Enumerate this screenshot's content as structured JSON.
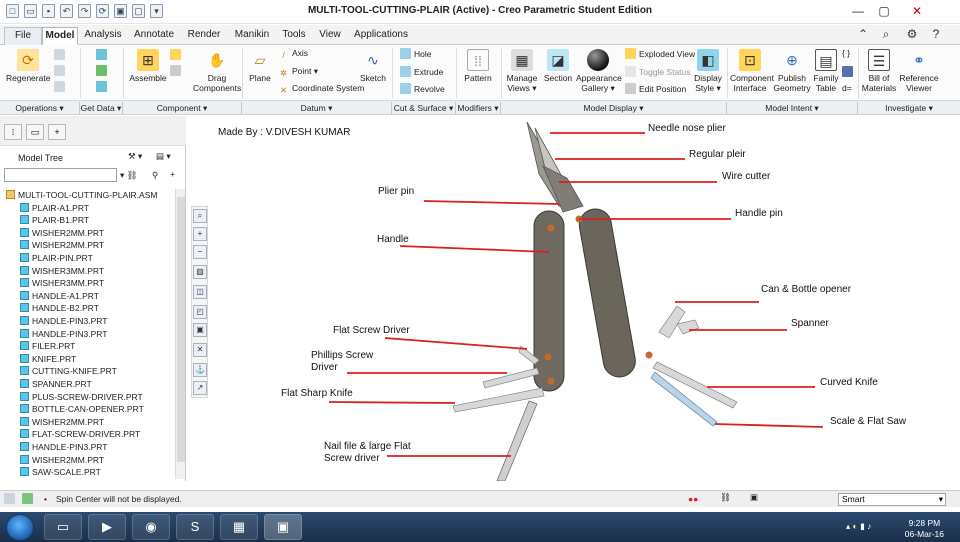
{
  "app": {
    "title": "MULTI-TOOL-CUTTING-PLAIR (Active) - Creo Parametric Student Edition"
  },
  "tabs": [
    "File",
    "Model",
    "Analysis",
    "Annotate",
    "Render",
    "Manikin",
    "Tools",
    "View",
    "Applications"
  ],
  "ribbon": {
    "regenerate": "Regenerate",
    "assemble": "Assemble",
    "drag_components_1": "Drag",
    "drag_components_2": "Components",
    "plane": "Plane",
    "axis": "Axis",
    "point": "Point",
    "coord_system": "Coordinate System",
    "sketch": "Sketch",
    "hole": "Hole",
    "extrude": "Extrude",
    "revolve": "Revolve",
    "pattern": "Pattern",
    "manage_views_1": "Manage",
    "manage_views_2": "Views",
    "section": "Section",
    "appearance_1": "Appearance",
    "appearance_2": "Gallery",
    "exploded_view": "Exploded View",
    "toggle_status": "Toggle Status",
    "edit_position": "Edit Position",
    "display_style_1": "Display",
    "display_style_2": "Style",
    "component_interface_1": "Component",
    "component_interface_2": "Interface",
    "publish_geometry_1": "Publish",
    "publish_geometry_2": "Geometry",
    "family_table_1": "Family",
    "family_table_2": "Table",
    "bill_of_materials_1": "Bill of",
    "bill_of_materials_2": "Materials",
    "reference_viewer_1": "Reference",
    "reference_viewer_2": "Viewer"
  },
  "groups": [
    "Operations",
    "Get Data",
    "Component",
    "Datum",
    "Cut & Surface",
    "Modifiers",
    "Model Display",
    "Model Intent",
    "Investigate"
  ],
  "model_tree": {
    "title": "Model Tree",
    "items": [
      "MULTI-TOOL-CUTTING-PLAIR.ASM",
      "PLAIR-A1.PRT",
      "PLAIR-B1.PRT",
      "WISHER2MM.PRT",
      "WISHER2MM.PRT",
      "PLAIR-PIN.PRT",
      "WISHER3MM.PRT",
      "WISHER3MM.PRT",
      "HANDLE-A1.PRT",
      "HANDLE-B2.PRT",
      "HANDLE-PIN3.PRT",
      "HANDLE-PIN3.PRT",
      "FILER.PRT",
      "KNIFE.PRT",
      "CUTTING-KNIFE.PRT",
      "SPANNER.PRT",
      "PLUS-SCREW-DRIVER.PRT",
      "BOTTLE-CAN-OPENER.PRT",
      "WISHER2MM.PRT",
      "FLAT-SCREW-DRIVER.PRT",
      "HANDLE-PIN3.PRT",
      "WISHER2MM.PRT",
      "SAW-SCALE.PRT"
    ]
  },
  "graphics": {
    "made_by": "Made By : V.DIVESH KUMAR",
    "labels": {
      "needle_nose": "Needle nose plier",
      "regular": "Regular pleir",
      "wire_cutter": "Wire cutter",
      "handle_pin": "Handle pin",
      "plier_pin": "Plier pin",
      "handle": "Handle",
      "can_opener": "Can & Bottle opener",
      "spanner": "Spanner",
      "flat_screw": "Flat Screw Driver",
      "phillips_1": "Phillips Screw",
      "phillips_2": "Driver",
      "flat_knife": "Flat Sharp Knife",
      "curved_knife": "Curved Knife",
      "scale_saw": "Scale & Flat Saw",
      "nail_file_1": "Nail file & large Flat",
      "nail_file_2": "Screw driver"
    }
  },
  "status": {
    "message": "Spin Center will not be displayed.",
    "filter": "Smart"
  },
  "taskbar": {
    "time": "9:28 PM",
    "date": "06-Mar-16"
  },
  "colors": {
    "leader": "#d91f1f",
    "handle_body": "#6e6a60",
    "blade": "#d8d8d8"
  }
}
